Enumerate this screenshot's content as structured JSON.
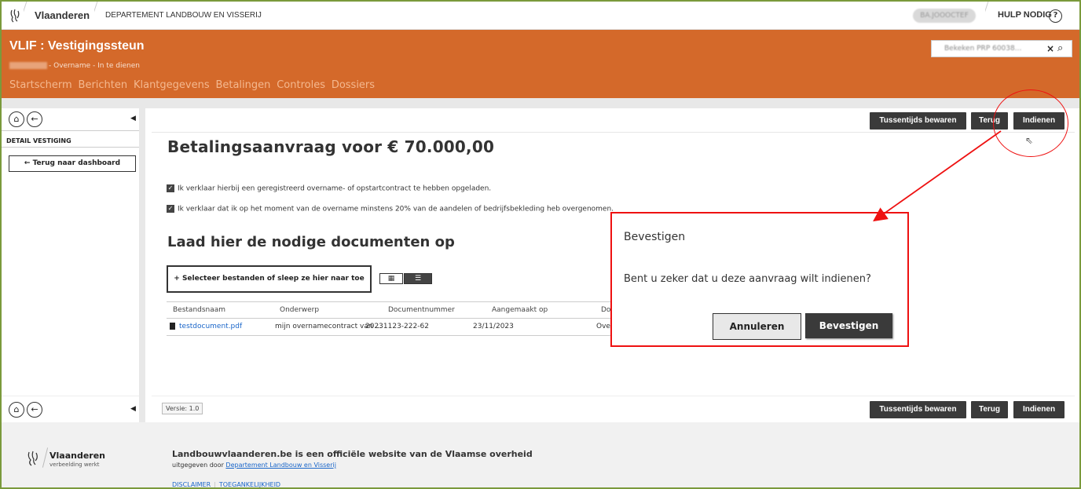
{
  "topbar": {
    "brand": "Vlaanderen",
    "department": "DEPARTEMENT LANDBOUW EN VISSERIJ",
    "user_badge": "BA.JOOOCTEF",
    "help_label": "HULP NODIG",
    "help_icon": "?"
  },
  "header": {
    "title": "VLIF : Vestigingssteun",
    "subtitle": "- Overname - In te dienen",
    "nav": [
      "Startscherm",
      "Berichten",
      "Klantgegevens",
      "Betalingen",
      "Controles",
      "Dossiers"
    ],
    "search_value": "Bekeken PRP 60038...",
    "search_clear": "×",
    "search_icon": "⌕"
  },
  "sidebar": {
    "home_icon": "⌂",
    "back_icon": "←",
    "collapse_icon": "◀",
    "section_title": "DETAIL VESTIGING",
    "back_button": "←  Terug naar dashboard"
  },
  "toolbar": {
    "save_label": "Tussentijds bewaren",
    "back_label": "Terug",
    "submit_label": "Indienen"
  },
  "main": {
    "title": "Betalingsaanvraag voor € 70.000,00",
    "checkbox_mark": "✓",
    "checks": [
      "Ik verklaar hierbij een geregistreerd overname- of opstartcontract te hebben opgeladen.",
      "Ik verklaar dat ik op het moment van de overname minstens 20% van de aandelen of bedrijfsbekleding heb overgenomen."
    ],
    "upload_title": "Laad hier de nodige documenten op",
    "select_button": "+ Selecteer bestanden of sleep ze hier naar toe",
    "grid_view_icon": "▦",
    "list_view_icon": "☰",
    "table": {
      "headers": [
        "Bestandsnaam",
        "Onderwerp",
        "Documentnummer",
        "Aangemaakt op",
        "Do"
      ],
      "rows": [
        {
          "name": "testdocument.pdf",
          "subject": "mijn overnamecontract van ...",
          "number": "20231123-222-62",
          "created": "23/11/2023",
          "extra": "Ove"
        }
      ]
    },
    "version": "Versie: 1.0"
  },
  "dialog": {
    "title": "Bevestigen",
    "message": "Bent u zeker dat u deze aanvraag wilt indienen?",
    "cancel_label": "Annuleren",
    "confirm_label": "Bevestigen"
  },
  "footer": {
    "brand": "Vlaanderen",
    "tagline": "verbeelding werkt",
    "title": "Landbouwvlaanderen.be is een officiële website van de Vlaamse overheid",
    "by_prefix": "uitgegeven door ",
    "by_link": "Departement Landbouw en Visserij",
    "links": [
      "DISCLAIMER",
      "TOEGANKELIJKHEID"
    ]
  },
  "colors": {
    "accent": "#d4692a",
    "dark_button": "#3a3a3a",
    "annotation_red": "#e11111",
    "link": "#1a66c9"
  }
}
